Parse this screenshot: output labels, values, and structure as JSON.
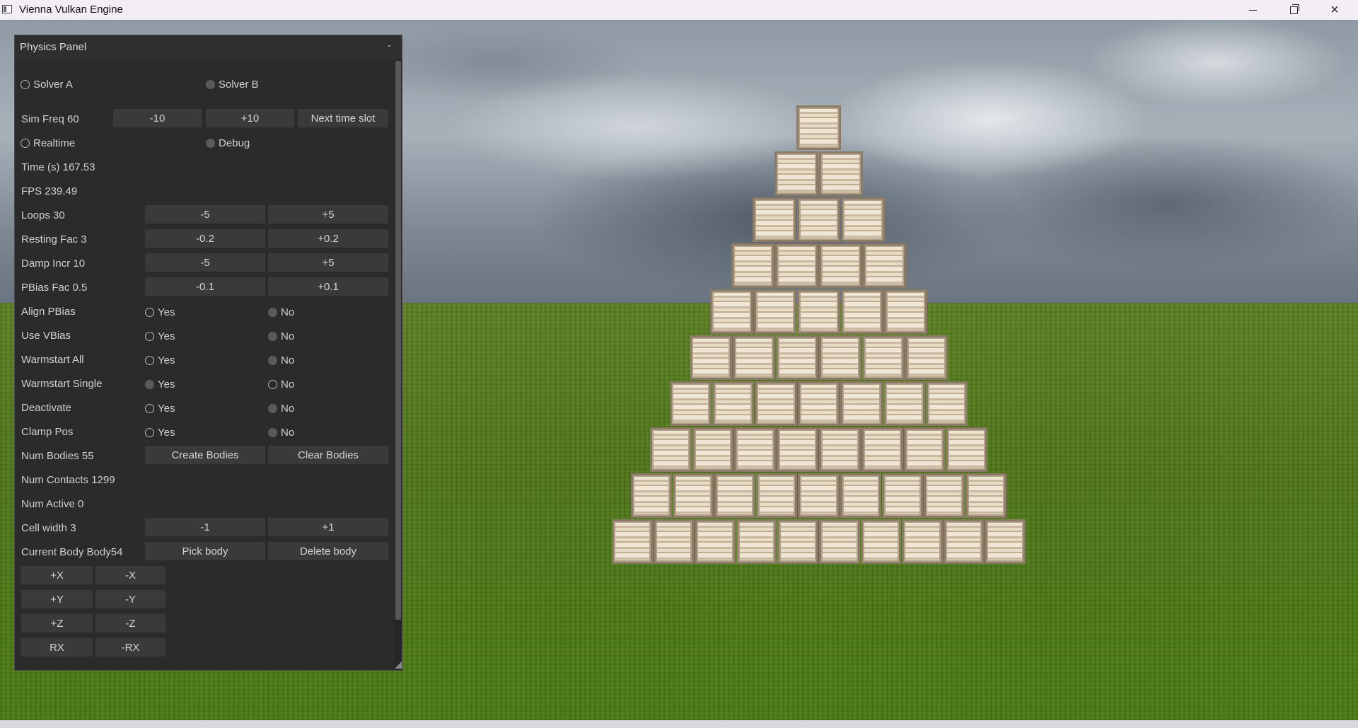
{
  "window": {
    "title": "Vienna Vulkan Engine",
    "buttons": {
      "minimize": "minimize",
      "maximize": "restore",
      "close": "×"
    }
  },
  "panel": {
    "title": "Physics Panel",
    "collapse": "-",
    "solver_a": "Solver A",
    "solver_b": "Solver B",
    "sim_freq": "Sim Freq 60",
    "sim_minus": "-10",
    "sim_plus": "+10",
    "next_slot": "Next time slot",
    "realtime": "Realtime",
    "debug": "Debug",
    "time": "Time (s)  167.53",
    "fps": "FPS 239.49",
    "rows": [
      {
        "label": "Loops 30",
        "minus": "-5",
        "plus": "+5"
      },
      {
        "label": "Resting Fac 3",
        "minus": "-0.2",
        "plus": "+0.2"
      },
      {
        "label": "Damp Incr 10",
        "minus": "-5",
        "plus": "+5"
      },
      {
        "label": "PBias Fac 0.5",
        "minus": "-0.1",
        "plus": "+0.1"
      }
    ],
    "toggles": [
      {
        "label": "Align PBias",
        "yes": "Yes",
        "no": "No",
        "selected": "no"
      },
      {
        "label": "Use VBias",
        "yes": "Yes",
        "no": "No",
        "selected": "no"
      },
      {
        "label": "Warmstart All",
        "yes": "Yes",
        "no": "No",
        "selected": "no"
      },
      {
        "label": "Warmstart Single",
        "yes": "Yes",
        "no": "No",
        "selected": "yes"
      },
      {
        "label": "Deactivate",
        "yes": "Yes",
        "no": "No",
        "selected": "no"
      },
      {
        "label": "Clamp Pos",
        "yes": "Yes",
        "no": "No",
        "selected": "no"
      }
    ],
    "num_bodies": "Num Bodies 55",
    "create_bodies": "Create Bodies",
    "clear_bodies": "Clear Bodies",
    "num_contacts": "Num Contacts 1299",
    "num_active": "Num Active 0",
    "cell_width": "Cell width 3",
    "cell_minus": "-1",
    "cell_plus": "+1",
    "current_body": "Current Body Body54",
    "pick_body": "Pick body",
    "delete_body": "Delete body",
    "move_buttons": [
      [
        "+X",
        "-X"
      ],
      [
        "+Y",
        "-Y"
      ],
      [
        "+Z",
        "-Z"
      ],
      [
        "RX",
        "-RX"
      ]
    ]
  },
  "scene": {
    "crate_rows": [
      1,
      2,
      3,
      4,
      5,
      6,
      7,
      8,
      9,
      10
    ]
  }
}
